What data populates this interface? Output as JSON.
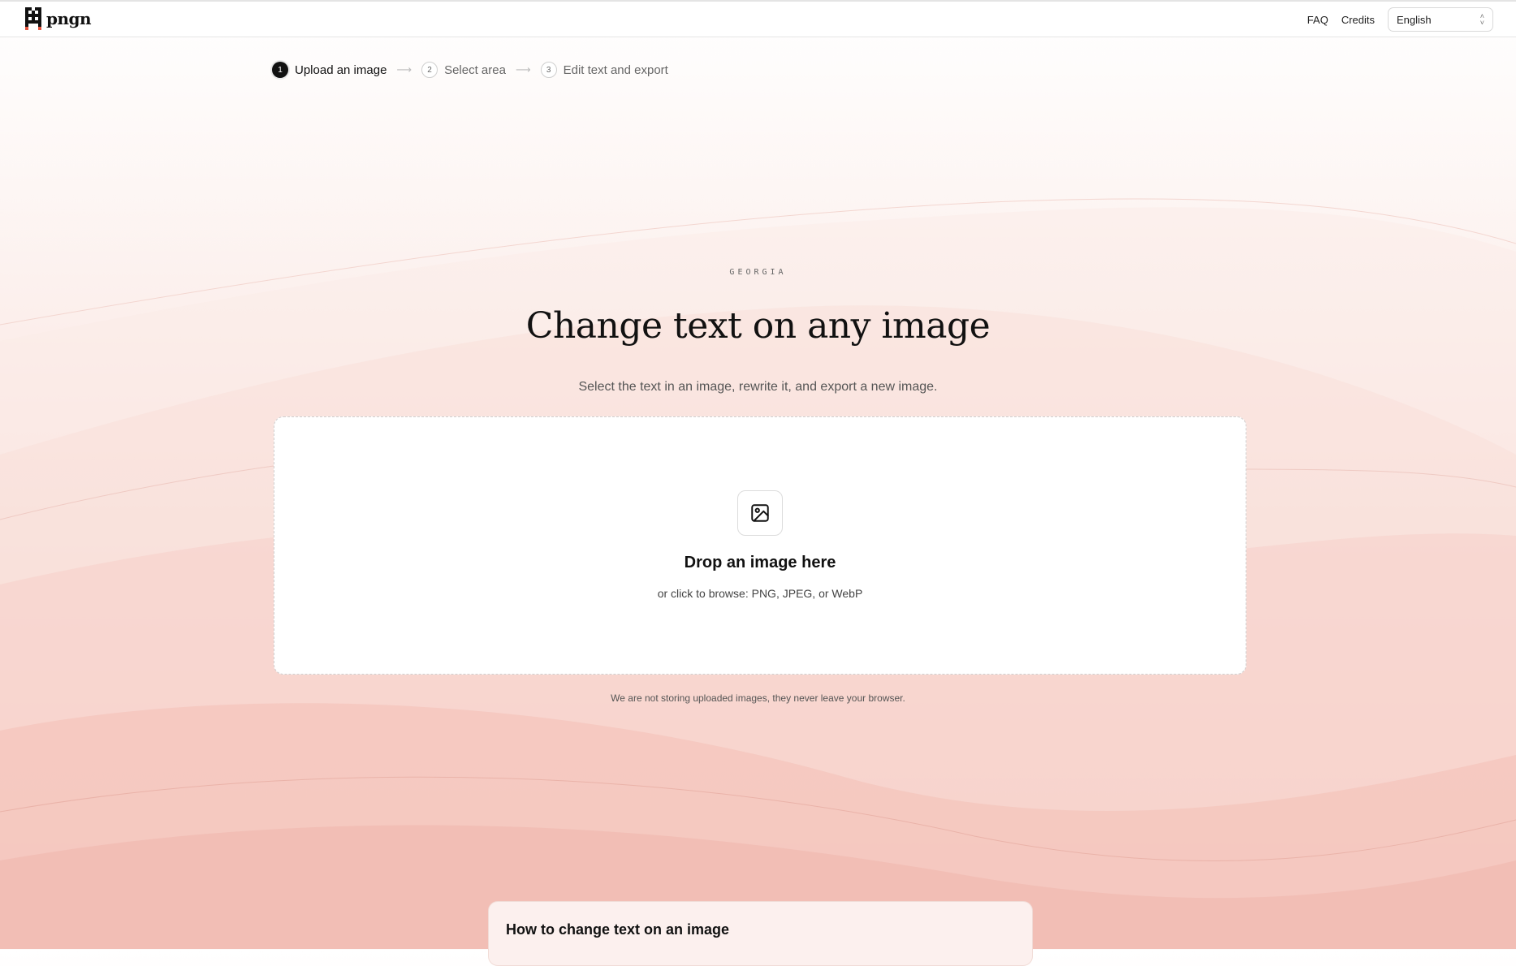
{
  "app": {
    "name": "pngn"
  },
  "nav": {
    "faq": "FAQ",
    "credits": "Credits",
    "language": "English"
  },
  "steps": [
    {
      "number": "1",
      "label": "Upload an image",
      "active": true
    },
    {
      "number": "2",
      "label": "Select area",
      "active": false
    },
    {
      "number": "3",
      "label": "Edit text and export",
      "active": false
    }
  ],
  "hero": {
    "eyebrow": "GEORGIA",
    "title": "Change text on any image",
    "subtitle": "Select the text in an image, rewrite it, and export a new image."
  },
  "dropzone": {
    "title": "Drop an image here",
    "subtitle": "or click to browse: PNG, JPEG, or WebP",
    "icon": "image-icon"
  },
  "privacy_note": "We are not storing uploaded images, they never leave your browser.",
  "howto": {
    "title": "How to change text on an image"
  },
  "colors": {
    "accent": "#111111",
    "background_warm": "#f4bcb3"
  }
}
